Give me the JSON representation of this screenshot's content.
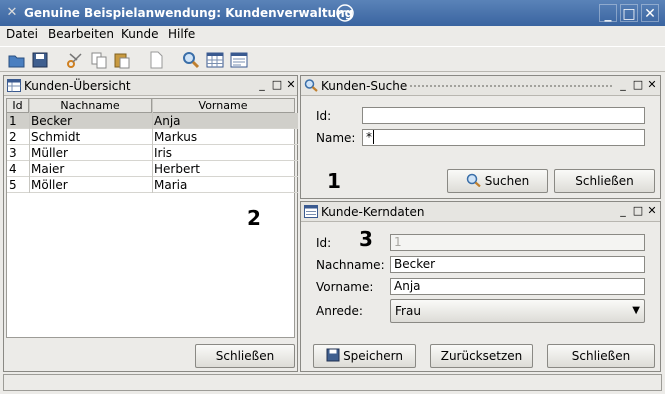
{
  "window": {
    "title": "Genuine Beispielanwendung: Kundenverwaltung"
  },
  "menu": [
    "Datei",
    "Bearbeiten",
    "Kunde",
    "Hilfe"
  ],
  "toolbar": [
    "open-icon",
    "save-icon",
    "cut-icon",
    "copy-icon",
    "paste-icon",
    "new-icon",
    "search-icon",
    "table-icon",
    "form-icon"
  ],
  "overview": {
    "title": "Kunden-Übersicht",
    "columns": [
      "Id",
      "Nachname",
      "Vorname"
    ],
    "rows": [
      [
        "1",
        "Becker",
        "Anja"
      ],
      [
        "2",
        "Schmidt",
        "Markus"
      ],
      [
        "3",
        "Müller",
        "Iris"
      ],
      [
        "4",
        "Maier",
        "Herbert"
      ],
      [
        "5",
        "Möller",
        "Maria"
      ]
    ],
    "close_label": "Schließen",
    "marker": "2"
  },
  "search": {
    "title": "Kunden-Suche",
    "id_label": "Id:",
    "id_value": "",
    "name_label": "Name:",
    "name_value": "*",
    "search_label": "Suchen",
    "close_label": "Schließen",
    "marker": "1"
  },
  "detail": {
    "title": "Kunde-Kerndaten",
    "id_label": "Id:",
    "id_value": "1",
    "lastname_label": "Nachname:",
    "lastname_value": "Becker",
    "firstname_label": "Vorname:",
    "firstname_value": "Anja",
    "salutation_label": "Anrede:",
    "salutation_value": "Frau",
    "save_label": "Speichern",
    "reset_label": "Zurücksetzen",
    "close_label": "Schließen",
    "marker": "3"
  },
  "colors": {
    "titlebar": "#3a64a0",
    "selection": "#d0cfca"
  }
}
